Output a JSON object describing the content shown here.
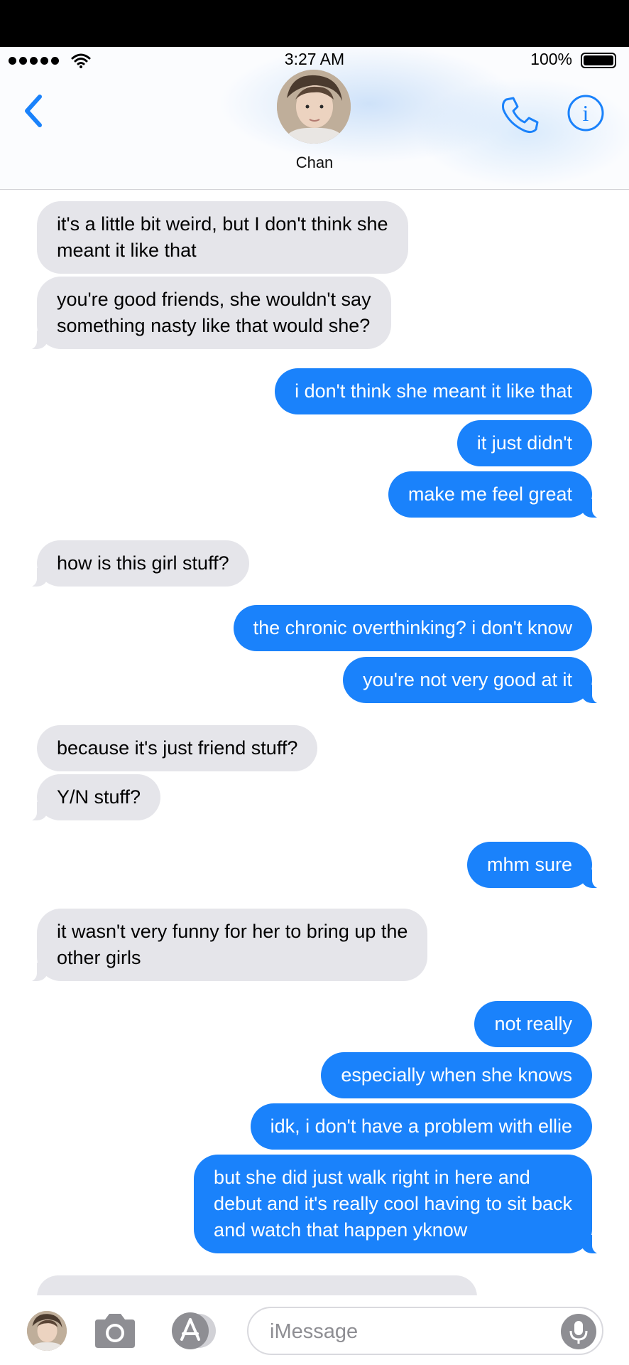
{
  "status_bar": {
    "time": "3:27 AM",
    "battery": "100%"
  },
  "header": {
    "contact_name": "Chan"
  },
  "messages": [
    {
      "side": "in",
      "text": "it's a little bit weird, but I don't think she\nmeant it like that",
      "tail": false
    },
    {
      "side": "in",
      "text": "you're good friends, she wouldn't say\nsomething nasty like that would she?",
      "tail": true
    },
    {
      "side": "out",
      "text": "i don't think she meant it like that",
      "tail": false
    },
    {
      "side": "out",
      "text": "it just didn't",
      "tail": false
    },
    {
      "side": "out",
      "text": "make me feel great",
      "tail": true
    },
    {
      "side": "in",
      "text": "how is this girl stuff?",
      "tail": true
    },
    {
      "side": "out",
      "text": "the chronic overthinking? i don't know",
      "tail": false
    },
    {
      "side": "out",
      "text": "you're not very good at it",
      "tail": true
    },
    {
      "side": "in",
      "text": "because it's just friend stuff?",
      "tail": false
    },
    {
      "side": "in",
      "text": "Y/N stuff?",
      "tail": true
    },
    {
      "side": "out",
      "text": "mhm sure",
      "tail": true
    },
    {
      "side": "in",
      "text": "it wasn't very funny for her to bring up the\nother girls",
      "tail": true
    },
    {
      "side": "out",
      "text": "not really",
      "tail": false
    },
    {
      "side": "out",
      "text": "especially when she knows",
      "tail": false
    },
    {
      "side": "out",
      "text": "idk, i don't have a problem with ellie",
      "tail": false
    },
    {
      "side": "out",
      "text": "but she did just walk right in here and\ndebut and it's really cool having to sit back\nand watch that happen yknow",
      "tail": true
    }
  ],
  "composer": {
    "placeholder": "iMessage"
  },
  "icons": [
    "back-chevron-icon",
    "phone-icon",
    "info-icon",
    "camera-icon",
    "app-store-icon",
    "microphone-icon"
  ],
  "colors": {
    "outgoing": "#1a82fb",
    "incoming": "#e5e5ea",
    "accent": "#1a82fb"
  }
}
